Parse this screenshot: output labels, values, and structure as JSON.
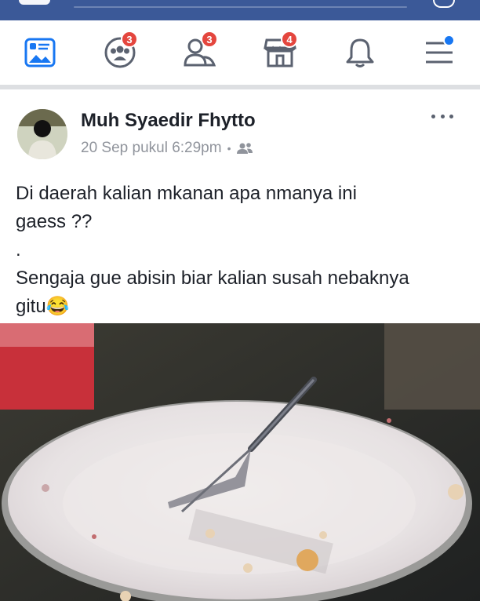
{
  "post": {
    "author": "Muh Syaedir Fhytto",
    "date": "20 Sep pukul 6:29pm",
    "separator": "•",
    "lines": [
      "Di daerah kalian mkanan apa nmanya ini",
      "gaess ??",
      ".",
      "Sengaja gue abisin biar kalian susah nebaknya",
      "gitu"
    ],
    "emoji": "😂"
  },
  "nav": {
    "badges": {
      "groups": "3",
      "friends": "3",
      "marketplace": "4"
    }
  },
  "icons": [
    "news-feed-icon",
    "groups-icon",
    "friend-requests-icon",
    "marketplace-icon",
    "notifications-icon",
    "menu-icon",
    "messenger-icon",
    "privacy-friends-icon",
    "more-options-icon"
  ],
  "colors": {
    "header": "#3b5998",
    "badge": "#e4463e",
    "accent": "#1877f2"
  }
}
